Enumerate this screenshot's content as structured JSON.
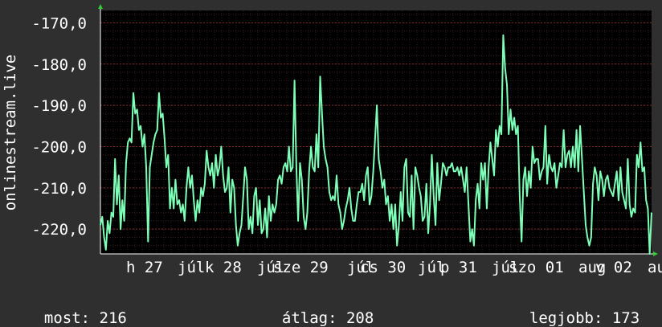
{
  "chart_data": {
    "type": "line",
    "ylabel": "onlinestream.live",
    "ylim": [
      -226,
      -167
    ],
    "y_ticks": [
      "-170,0",
      "-180,0",
      "-190,0",
      "-200,0",
      "-210,0",
      "-220,0"
    ],
    "y_tick_values": [
      -170,
      -180,
      -190,
      -200,
      -210,
      -220
    ],
    "x_range": [
      0,
      100
    ],
    "x_ticks": [
      {
        "label": "h 27",
        "at": 5.5
      },
      {
        "label": "júl",
        "at": 16.6
      },
      {
        "label": "k 28",
        "at": 23.6
      },
      {
        "label": "júl",
        "at": 34.7
      },
      {
        "label": "sze 29",
        "at": 41.6
      },
      {
        "label": "júl",
        "at": 52.8
      },
      {
        "label": "cs 30",
        "at": 59.7
      },
      {
        "label": "júl",
        "at": 70.8
      },
      {
        "label": "p 31",
        "at": 77.8
      },
      {
        "label": "júl",
        "at": 88.9
      },
      {
        "label": "szo 01",
        "at": 95.8
      },
      {
        "label": "aug",
        "at": 0
      },
      {
        "label": "v 02",
        "at": 0
      },
      {
        "label": "aug",
        "at": 0
      }
    ],
    "series": [
      {
        "color": "#7dffb8",
        "y": [
          -219,
          -217,
          -222,
          -225,
          -218,
          -221,
          -216,
          -217,
          -203,
          -214,
          -207,
          -220,
          -213,
          -218,
          -204,
          -199,
          -198,
          -199,
          -187,
          -192,
          -191,
          -196,
          -195,
          -200,
          -197,
          -205,
          -223,
          -205,
          -202,
          -199,
          -197,
          -196,
          -187,
          -193,
          -192,
          -198,
          -205,
          -202,
          -215,
          -210,
          -215,
          -208,
          -214,
          -213,
          -216,
          -214,
          -218,
          -210,
          -205,
          -210,
          -207,
          -213,
          -218,
          -213,
          -216,
          -210,
          -212,
          -209,
          -201,
          -205,
          -207,
          -204,
          -210,
          -202,
          -207,
          -205,
          -200,
          -207,
          -211,
          -210,
          -205,
          -216,
          -208,
          -210,
          -219,
          -224,
          -221,
          -219,
          -212,
          -205,
          -208,
          -220,
          -217,
          -221,
          -212,
          -210,
          -219,
          -213,
          -221,
          -220,
          -215,
          -222,
          -212,
          -218,
          -214,
          -216,
          -214,
          -208,
          -207,
          -209,
          -205,
          -204,
          -206,
          -200,
          -206,
          -205,
          -184,
          -205,
          -218,
          -204,
          -208,
          -217,
          -220,
          -216,
          -206,
          -200,
          -205,
          -206,
          -197,
          -205,
          -183,
          -192,
          -200,
          -203,
          -205,
          -211,
          -213,
          -212,
          -213,
          -207,
          -214,
          -216,
          -220,
          -218,
          -215,
          -213,
          -210,
          -215,
          -218,
          -218,
          -214,
          -211,
          -211,
          -209,
          -213,
          -207,
          -205,
          -214,
          -212,
          -206,
          -198,
          -190,
          -203,
          -206,
          -210,
          -208,
          -214,
          -212,
          -218,
          -214,
          -220,
          -214,
          -224,
          -219,
          -211,
          -218,
          -205,
          -203,
          -216,
          -217,
          -207,
          -220,
          -205,
          -207,
          -210,
          -212,
          -218,
          -217,
          -209,
          -221,
          -214,
          -202,
          -212,
          -219,
          -204,
          -213,
          -209,
          -204,
          -205,
          -207,
          -205,
          -205,
          -204,
          -206,
          -206,
          -205,
          -207,
          -205,
          -208,
          -211,
          -205,
          -214,
          -223,
          -220,
          -224,
          -213,
          -209,
          -215,
          -204,
          -208,
          -204,
          -215,
          -205,
          -199,
          -203,
          -207,
          -196,
          -200,
          -195,
          -197,
          -173,
          -181,
          -185,
          -197,
          -191,
          -196,
          -193,
          -197,
          -195,
          -212,
          -223,
          -208,
          -205,
          -212,
          -206,
          -210,
          -200,
          -204,
          -203,
          -203,
          -208,
          -206,
          -205,
          -195,
          -209,
          -202,
          -205,
          -206,
          -204,
          -210,
          -207,
          -204,
          -205,
          -196,
          -205,
          -202,
          -201,
          -205,
          -200,
          -205,
          -196,
          -206,
          -195,
          -203,
          -211,
          -219,
          -222,
          -224,
          -222,
          -209,
          -205,
          -207,
          -213,
          -206,
          -208,
          -212,
          -208,
          -207,
          -210,
          -211,
          -212,
          -209,
          -206,
          -213,
          -205,
          -211,
          -213,
          -215,
          -203,
          -214,
          -217,
          -215,
          -216,
          -202,
          -205,
          -199,
          -206,
          -205,
          -213,
          -215,
          -226,
          -216
        ]
      }
    ],
    "stats": {
      "current_label": "most:",
      "current_value": "216",
      "avg_label": "átlag:",
      "avg_value": "208",
      "best_label": "legjobb:",
      "best_value": "173"
    }
  }
}
